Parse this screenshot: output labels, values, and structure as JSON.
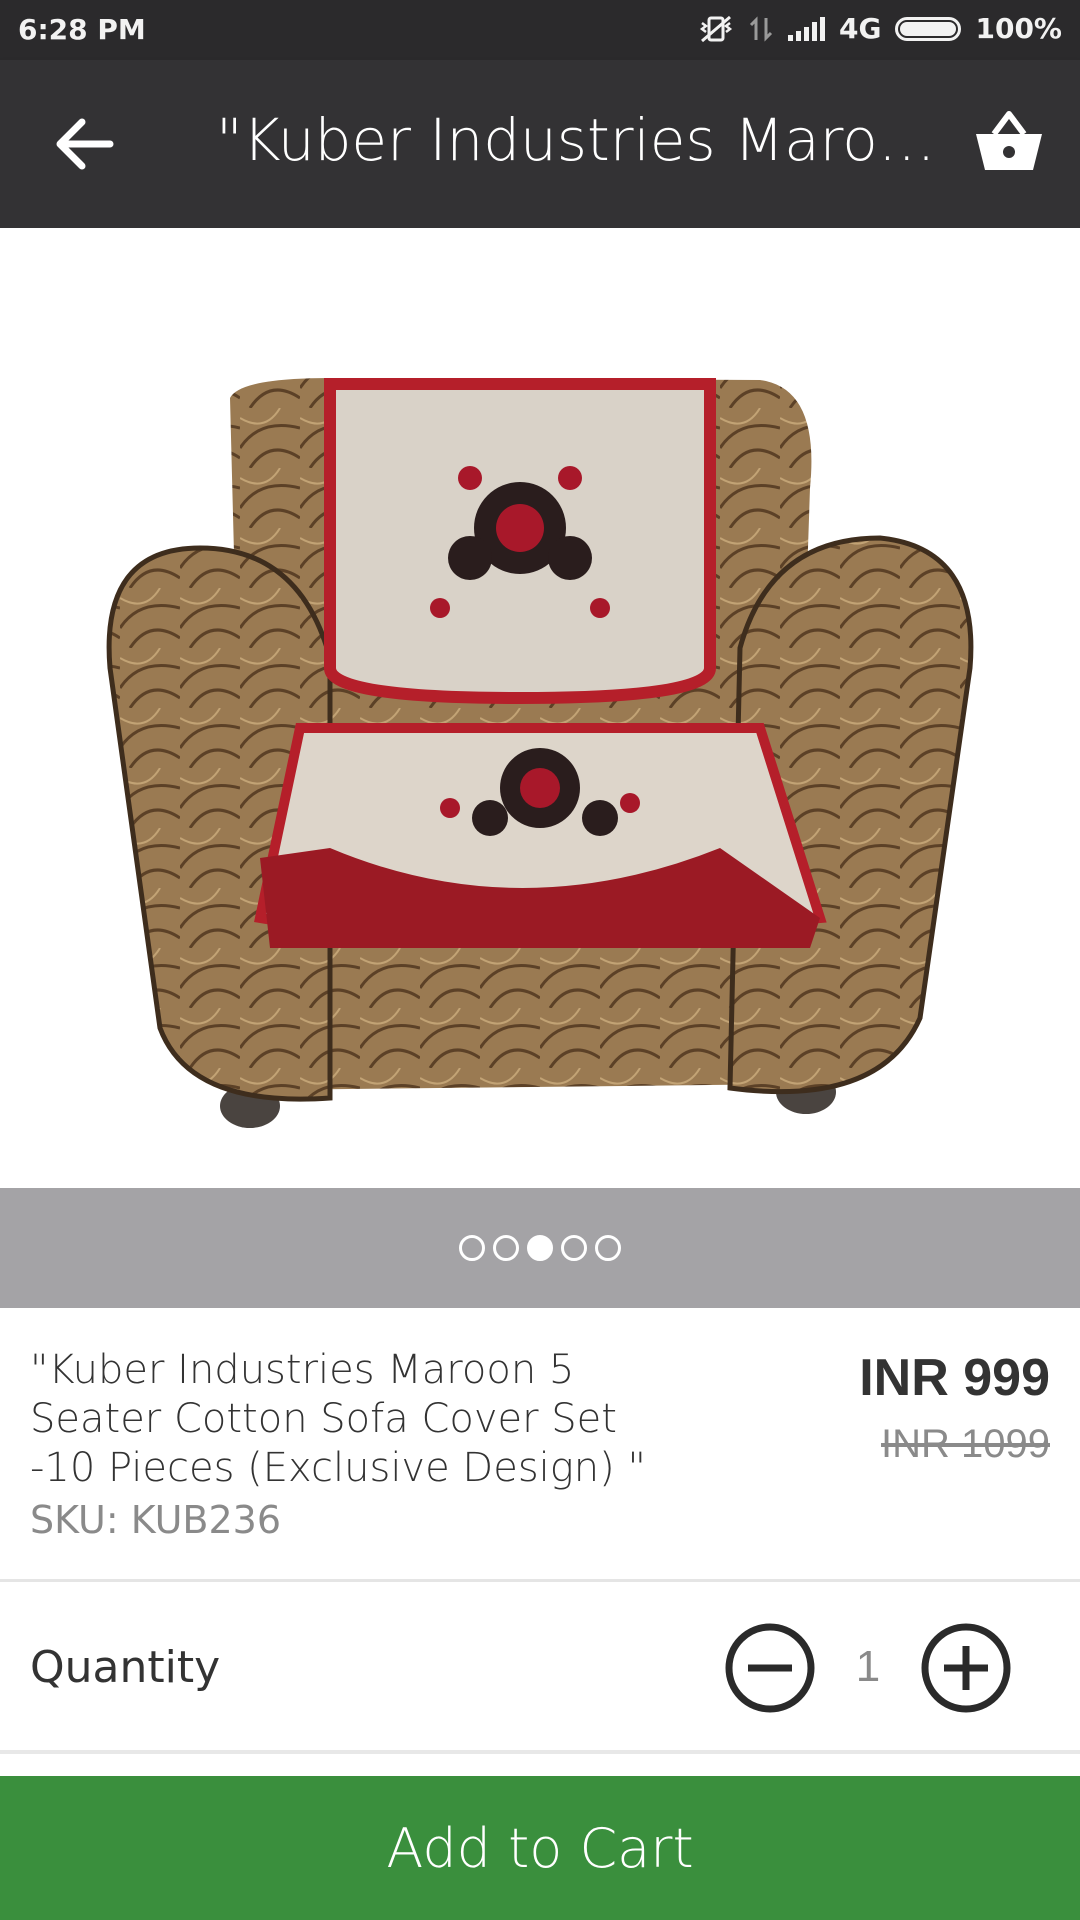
{
  "status_bar": {
    "time": "6:28 PM",
    "network": "4G",
    "battery": "100%"
  },
  "toolbar": {
    "title": "\"Kuber Industries Maroon 5 Seater Cotton Sofa Cover Set -10 Pieces (Exclusive Design) \"",
    "back_icon": "arrow-left-icon",
    "cart_icon": "shopping-basket-icon"
  },
  "gallery": {
    "image_count": 5,
    "active_index": 2
  },
  "product": {
    "name": "\"Kuber Industries Maroon 5 Seater Cotton Sofa Cover Set -10 Pieces (Exclusive Design) \"",
    "sku": "SKU: KUB236",
    "price": "INR 999",
    "old_price": "INR 1099"
  },
  "quantity": {
    "label": "Quantity",
    "value": "1"
  },
  "add_to_cart": {
    "label": "Add to Cart",
    "color": "#3a8f3d"
  }
}
